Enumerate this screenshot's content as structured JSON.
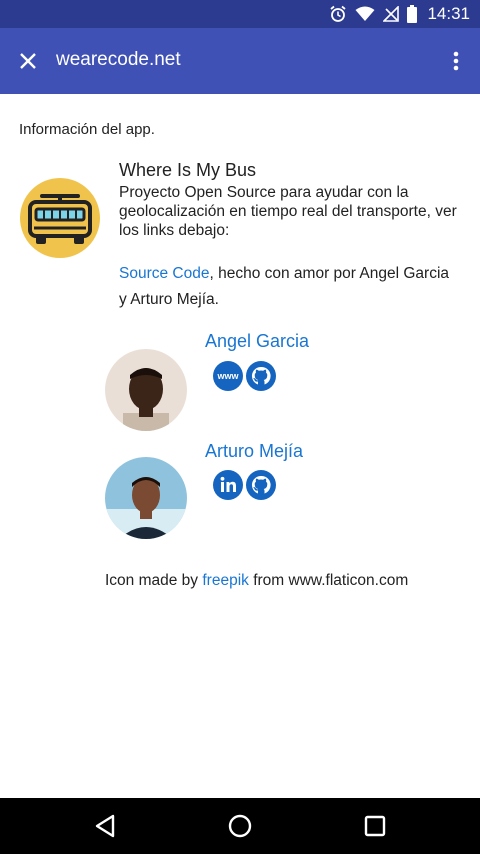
{
  "status_bar": {
    "time": "14:31"
  },
  "toolbar": {
    "title": "wearecode.net"
  },
  "intro": "Información del app.",
  "app": {
    "title": "Where Is My Bus",
    "description": "Proyecto Open Source para ayudar con la geolocalización en tiempo real del transporte, ver los links debajo:",
    "source_link": "Source Code",
    "credit_rest": ", hecho con amor por Angel Garcia y Arturo Mejía."
  },
  "people": [
    {
      "name": "Angel Garcia",
      "links": [
        "www-icon",
        "github-icon"
      ]
    },
    {
      "name": "Arturo Mejía",
      "links": [
        "linkedin-icon",
        "github-icon"
      ]
    }
  ],
  "footer": {
    "prefix": "Icon made by ",
    "link": "freepik",
    "suffix": " from www.flaticon.com"
  },
  "colors": {
    "status_bar": "#2c3a8f",
    "toolbar": "#3f51b5",
    "link": "#1976d2",
    "bus_circle": "#f0c44c",
    "social": "#1565c0"
  }
}
